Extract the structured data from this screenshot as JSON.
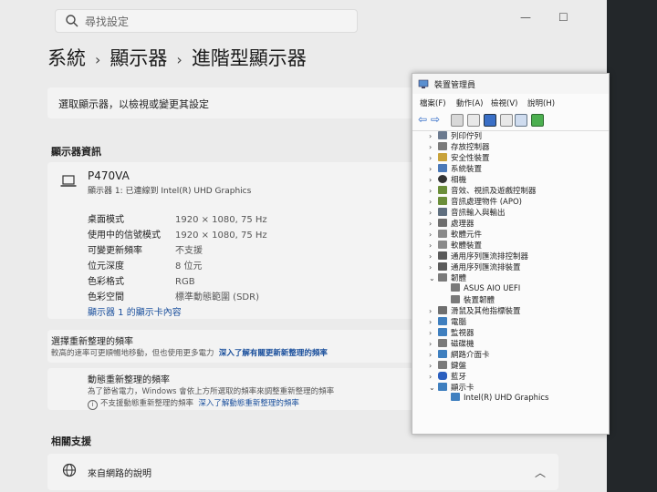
{
  "settings": {
    "search_placeholder": "尋找設定",
    "window_controls": {
      "minimize": "—",
      "maximize": "☐"
    },
    "breadcrumb": [
      "系統",
      "顯示器",
      "進階型顯示器"
    ],
    "select_display_text": "選取顯示器，以檢視或變更其設定",
    "display_info_title": "顯示器資訊",
    "device_name": "P470VA",
    "device_subtitle": "顯示器 1: 已連線到 Intel(R) UHD Graphics",
    "properties": [
      {
        "label": "桌面模式",
        "value": "1920 × 1080, 75 Hz"
      },
      {
        "label": "使用中的信號模式",
        "value": "1920 × 1080, 75 Hz"
      },
      {
        "label": "可變更新頻率",
        "value": "不支援"
      },
      {
        "label": "位元深度",
        "value": "8 位元"
      },
      {
        "label": "色彩格式",
        "value": "RGB"
      },
      {
        "label": "色彩空間",
        "value": "標準動態範圍 (SDR)"
      }
    ],
    "adapter_link": "顯示器 1 的顯示卡內容",
    "refresh_title": "選擇重新整理的頻率",
    "refresh_desc": "較高的速率可更順暢地移動，但也使用更多電力",
    "refresh_link": "深入了解有關更新新整理的頻率",
    "dynamic_title": "動態重新整理的頻率",
    "dynamic_desc": "為了節省電力，Windows 會依上方所選取的頻率來調整重新整理的頻率",
    "dynamic_note": "不支援動態重新整理的頻率",
    "dynamic_link": "深入了解動態重新整理的頻率",
    "related_support_title": "相關支援",
    "help_text": "來自網路的說明"
  },
  "device_manager": {
    "title": "裝置管理員",
    "menu": [
      "檔案(F)",
      "動作(A)",
      "檢視(V)",
      "說明(H)"
    ],
    "tree": [
      {
        "label": "列印佇列",
        "expanded": false,
        "color": "#6b7a8f"
      },
      {
        "label": "存放控制器",
        "expanded": false,
        "color": "#7a7a7a"
      },
      {
        "label": "安全性裝置",
        "expanded": false,
        "color": "#c8a23a"
      },
      {
        "label": "系統裝置",
        "expanded": false,
        "color": "#4b79b8"
      },
      {
        "label": "相機",
        "expanded": false,
        "color": "#333333"
      },
      {
        "label": "音效、視訊及遊戲控制器",
        "expanded": false,
        "color": "#6b8e3a"
      },
      {
        "label": "音訊處理物件 (APO)",
        "expanded": false,
        "color": "#6b8e3a"
      },
      {
        "label": "音訊輸入與輸出",
        "expanded": false,
        "color": "#5f6f7f"
      },
      {
        "label": "處理器",
        "expanded": false,
        "color": "#6f6f6f"
      },
      {
        "label": "軟體元件",
        "expanded": false,
        "color": "#8a8a8a"
      },
      {
        "label": "軟體裝置",
        "expanded": false,
        "color": "#8a8a8a"
      },
      {
        "label": "通用序列匯流排控制器",
        "expanded": false,
        "color": "#5a5a5a"
      },
      {
        "label": "通用序列匯流排裝置",
        "expanded": false,
        "color": "#5a5a5a"
      },
      {
        "label": "韌體",
        "expanded": true,
        "color": "#7a7a7a"
      },
      {
        "label": "ASUS AIO UEFI",
        "child": true,
        "color": "#7a7a7a"
      },
      {
        "label": "裝置韌體",
        "child": true,
        "color": "#7a7a7a"
      },
      {
        "label": "滑鼠及其他指標裝置",
        "expanded": false,
        "color": "#6f6f6f"
      },
      {
        "label": "電腦",
        "expanded": false,
        "color": "#3f7fbf"
      },
      {
        "label": "監視器",
        "expanded": false,
        "color": "#3f7fbf"
      },
      {
        "label": "磁碟機",
        "expanded": false,
        "color": "#7a7a7a"
      },
      {
        "label": "網路介面卡",
        "expanded": false,
        "color": "#3f7fbf"
      },
      {
        "label": "鍵盤",
        "expanded": false,
        "color": "#7a7a7a"
      },
      {
        "label": "藍牙",
        "expanded": false,
        "color": "#2a5fbf"
      },
      {
        "label": "顯示卡",
        "expanded": true,
        "color": "#3f7fbf"
      },
      {
        "label": "Intel(R) UHD Graphics",
        "child": true,
        "color": "#3f7fbf"
      }
    ]
  }
}
